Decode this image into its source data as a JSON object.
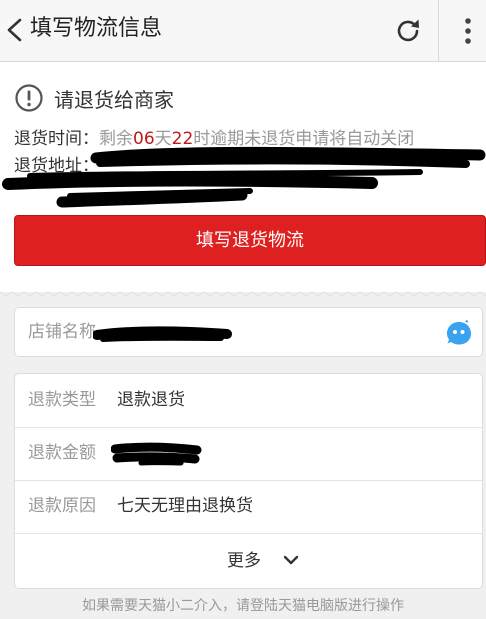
{
  "header": {
    "title": "填写物流信息",
    "back_icon": "chevron-left-icon",
    "refresh_icon": "refresh-icon",
    "more_icon": "vertical-dots-icon"
  },
  "notice": {
    "icon": "exclamation-circle-icon",
    "title": "请退货给商家",
    "time_label": "退货时间：",
    "time_prefix": "剩余",
    "days": "06",
    "days_unit": "天",
    "hours": "22",
    "time_suffix": "时逾期未退货申请将自动关闭",
    "address_label": "退货地址：",
    "fill_button": "填写退货物流"
  },
  "shop": {
    "label": "店铺名称",
    "chat_icon": "chat-bubble-icon"
  },
  "refund": {
    "rows": [
      {
        "label": "退款类型",
        "value": "退款退货"
      },
      {
        "label": "退款金额",
        "value": ""
      },
      {
        "label": "退款原因",
        "value": "七天无理由退换货"
      }
    ],
    "more_label": "更多"
  },
  "footer": {
    "note": "如果需要天猫小二介入，请登陆天猫电脑版进行操作"
  },
  "colors": {
    "accent_red": "#df2020",
    "countdown_red": "#c01818",
    "muted_text": "#999999"
  }
}
